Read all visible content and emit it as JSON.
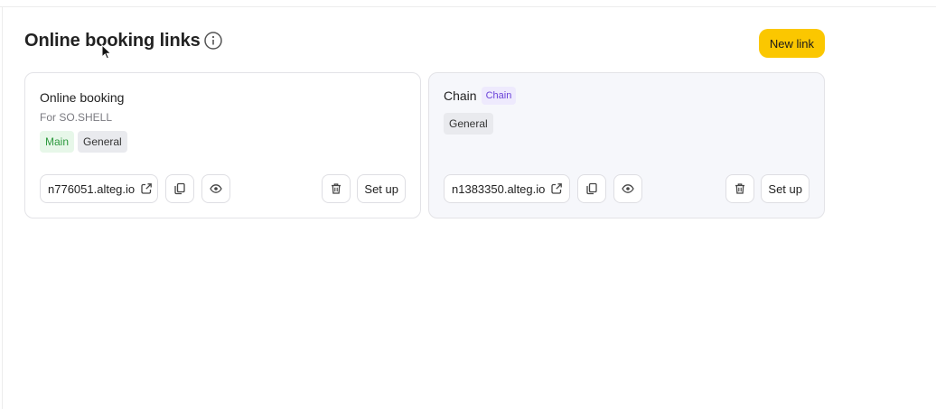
{
  "header": {
    "title": "Online booking links",
    "new_link_label": "New link"
  },
  "cards": [
    {
      "title": "Online booking",
      "subtitle": "For SO.SHELL",
      "tags": [
        "Main",
        "General"
      ],
      "link": "n776051.alteg.io",
      "setup_label": "Set up"
    },
    {
      "title": "Chain",
      "title_badge": "Chain",
      "tags": [
        "General"
      ],
      "link": "n1383350.alteg.io",
      "setup_label": "Set up"
    }
  ],
  "colors": {
    "accent": "#fbc700",
    "tag_main_bg": "#e7f7e9",
    "tag_main_text": "#2e9a3f",
    "tag_chain_bg": "#eeeafd",
    "tag_chain_text": "#6a43d8"
  },
  "icons": [
    "info-icon",
    "external-link-icon",
    "copy-icon",
    "eye-icon",
    "trash-icon",
    "mouse-cursor-icon"
  ]
}
